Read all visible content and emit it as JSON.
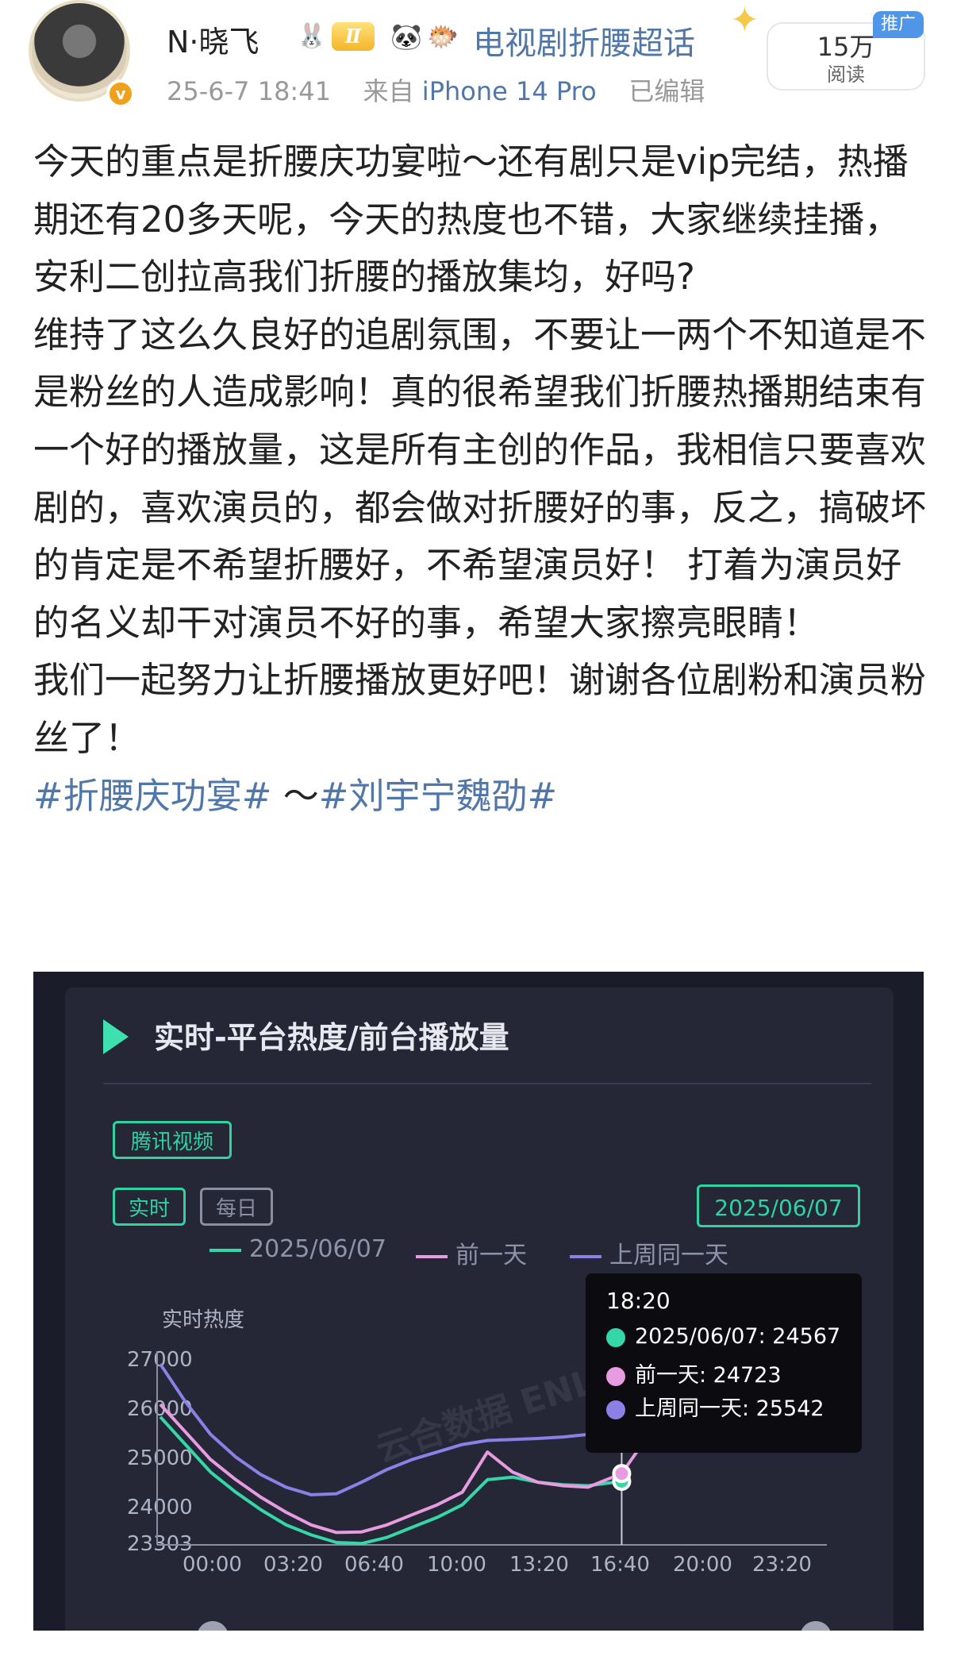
{
  "header": {
    "username": "N·晓飞",
    "level_badge": "Ⅱ",
    "topic": "电视剧折腰超话",
    "date": "25-6-7 18:41",
    "source_prefix": "来自",
    "source_device": "iPhone 14 Pro",
    "edited": "已编辑",
    "reads_count": "15万",
    "reads_label": "阅读",
    "ad_tag": "推广",
    "verified_icon": "v"
  },
  "post": {
    "paragraphs": [
      "今天的重点是折腰庆功宴啦～还有剧只是vip完结，热播期还有20多天呢，今天的热度也不错，大家继续挂播，安利二创拉高我们折腰的播放集均，好吗?",
      "维持了这么久良好的追剧氛围，不要让一两个不知道是不是粉丝的人造成影响！真的很希望我们折腰热播期结束有一个好的播放量，这是所有主创的作品，我相信只要喜欢剧的，喜欢演员的，都会做对折腰好的事，反之，搞破坏的肯定是不希望折腰好，不希望演员好！ 打着为演员好的名义却干对演员不好的事，希望大家擦亮眼睛！",
      "我们一起努力让折腰播放更好吧！谢谢各位剧粉和演员粉丝了！"
    ],
    "tag1": "#折腰庆功宴#",
    "tag_sep": " ～",
    "tag2": "#刘宇宁魏劭#"
  },
  "screenshot": {
    "title": "实时-平台热度/前台播放量",
    "platform_chip": "腾讯视频",
    "mode_realtime": "实时",
    "mode_daily": "每日",
    "date_chip": "2025/06/07",
    "watermark": "云合数据 ENLIGHTENT"
  },
  "chart_data": {
    "type": "line",
    "ylabel": "实时热度",
    "ylim": [
      23303,
      27000
    ],
    "yticks": [
      "27000",
      "26000",
      "25000",
      "24000",
      "23303"
    ],
    "xticks": [
      "00:00",
      "03:20",
      "06:40",
      "10:00",
      "13:20",
      "16:40",
      "20:00",
      "23:20"
    ],
    "x": [
      "00:00",
      "01:00",
      "02:00",
      "03:00",
      "04:00",
      "05:00",
      "06:00",
      "07:00",
      "08:00",
      "09:00",
      "10:00",
      "11:00",
      "12:00",
      "13:00",
      "14:00",
      "15:00",
      "16:00",
      "17:00",
      "18:20",
      "19:00",
      "20:00"
    ],
    "series": [
      {
        "name": "2025/06/07",
        "color": "#35d6a8",
        "values": [
          25850,
          25300,
          24750,
          24350,
          24000,
          23700,
          23500,
          23350,
          23330,
          23450,
          23650,
          23850,
          24100,
          24600,
          24650,
          24550,
          24500,
          24480,
          24567,
          null,
          null
        ]
      },
      {
        "name": "前一天",
        "color": "#e79be0",
        "values": [
          26100,
          25550,
          25000,
          24600,
          24250,
          23950,
          23700,
          23550,
          23560,
          23700,
          23900,
          24100,
          24350,
          25150,
          24750,
          24550,
          24480,
          24450,
          24723,
          25200,
          25600
        ]
      },
      {
        "name": "上周同一天",
        "color": "#8a80e6",
        "values": [
          26900,
          26150,
          25500,
          25050,
          24700,
          24450,
          24300,
          24320,
          24550,
          24800,
          25000,
          25150,
          25300,
          25380,
          25400,
          25420,
          25450,
          25500,
          25542,
          null,
          null
        ]
      }
    ],
    "tooltip": {
      "time": "18:20",
      "rows": [
        {
          "label": "2025/06/07: 24567",
          "color": "#35d6a8"
        },
        {
          "label": "前一天: 24723",
          "color": "#e79be0"
        },
        {
          "label": "上周同一天: 25542",
          "color": "#8a80e6"
        }
      ]
    },
    "grid": false,
    "legend": "top"
  }
}
